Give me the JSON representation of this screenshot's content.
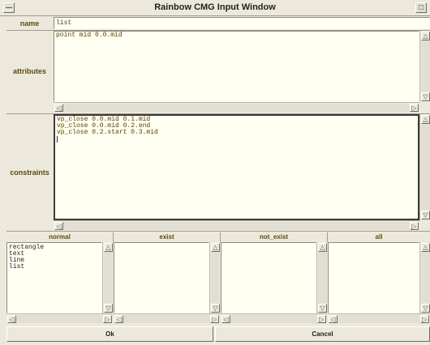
{
  "window": {
    "title": "Rainbow CMG Input Window",
    "left_button_icon": "menu-icon",
    "right_button_icon": "maximize-icon"
  },
  "fields": {
    "name": {
      "label": "name",
      "value": "list"
    },
    "attributes": {
      "label": "attributes",
      "lines": [
        "point mid 0.0.mid"
      ]
    },
    "constraints": {
      "label": "constraints",
      "lines": [
        "vp_close 0.0.mid 0.1.mid",
        "vp_close 0.0.mid 0.2.end",
        "vp_close 0.2.start 0.3.mid"
      ]
    }
  },
  "lists": {
    "normal": {
      "label": "normal",
      "items": [
        "rectangle",
        "text",
        "line",
        "list"
      ]
    },
    "exist": {
      "label": "exist",
      "items": []
    },
    "not_exist": {
      "label": "not_exist",
      "items": []
    },
    "all": {
      "label": "all",
      "items": []
    }
  },
  "buttons": {
    "ok": "Ok",
    "cancel": "Cancel"
  },
  "colors": {
    "field_background": "#fffff2",
    "window_background": "#ece9dc",
    "label_color": "#5a4a10",
    "text_color": "#5b4200"
  }
}
